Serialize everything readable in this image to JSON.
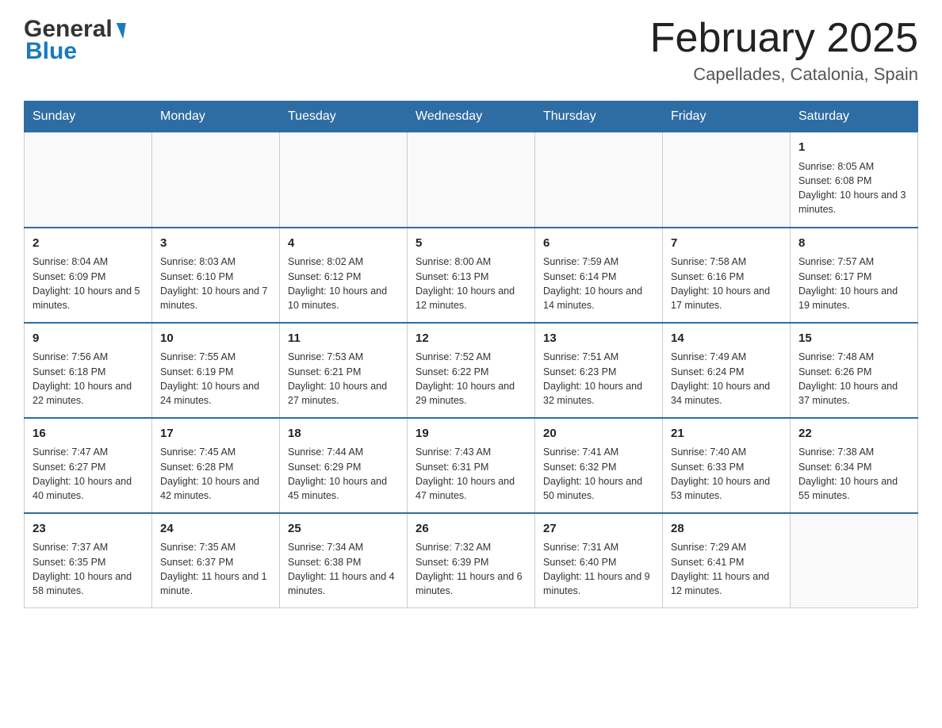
{
  "header": {
    "logo_general": "General",
    "logo_blue": "Blue",
    "title": "February 2025",
    "subtitle": "Capellades, Catalonia, Spain"
  },
  "days_of_week": [
    "Sunday",
    "Monday",
    "Tuesday",
    "Wednesday",
    "Thursday",
    "Friday",
    "Saturday"
  ],
  "weeks": [
    [
      {
        "day": "",
        "info": ""
      },
      {
        "day": "",
        "info": ""
      },
      {
        "day": "",
        "info": ""
      },
      {
        "day": "",
        "info": ""
      },
      {
        "day": "",
        "info": ""
      },
      {
        "day": "",
        "info": ""
      },
      {
        "day": "1",
        "info": "Sunrise: 8:05 AM\nSunset: 6:08 PM\nDaylight: 10 hours and 3 minutes."
      }
    ],
    [
      {
        "day": "2",
        "info": "Sunrise: 8:04 AM\nSunset: 6:09 PM\nDaylight: 10 hours and 5 minutes."
      },
      {
        "day": "3",
        "info": "Sunrise: 8:03 AM\nSunset: 6:10 PM\nDaylight: 10 hours and 7 minutes."
      },
      {
        "day": "4",
        "info": "Sunrise: 8:02 AM\nSunset: 6:12 PM\nDaylight: 10 hours and 10 minutes."
      },
      {
        "day": "5",
        "info": "Sunrise: 8:00 AM\nSunset: 6:13 PM\nDaylight: 10 hours and 12 minutes."
      },
      {
        "day": "6",
        "info": "Sunrise: 7:59 AM\nSunset: 6:14 PM\nDaylight: 10 hours and 14 minutes."
      },
      {
        "day": "7",
        "info": "Sunrise: 7:58 AM\nSunset: 6:16 PM\nDaylight: 10 hours and 17 minutes."
      },
      {
        "day": "8",
        "info": "Sunrise: 7:57 AM\nSunset: 6:17 PM\nDaylight: 10 hours and 19 minutes."
      }
    ],
    [
      {
        "day": "9",
        "info": "Sunrise: 7:56 AM\nSunset: 6:18 PM\nDaylight: 10 hours and 22 minutes."
      },
      {
        "day": "10",
        "info": "Sunrise: 7:55 AM\nSunset: 6:19 PM\nDaylight: 10 hours and 24 minutes."
      },
      {
        "day": "11",
        "info": "Sunrise: 7:53 AM\nSunset: 6:21 PM\nDaylight: 10 hours and 27 minutes."
      },
      {
        "day": "12",
        "info": "Sunrise: 7:52 AM\nSunset: 6:22 PM\nDaylight: 10 hours and 29 minutes."
      },
      {
        "day": "13",
        "info": "Sunrise: 7:51 AM\nSunset: 6:23 PM\nDaylight: 10 hours and 32 minutes."
      },
      {
        "day": "14",
        "info": "Sunrise: 7:49 AM\nSunset: 6:24 PM\nDaylight: 10 hours and 34 minutes."
      },
      {
        "day": "15",
        "info": "Sunrise: 7:48 AM\nSunset: 6:26 PM\nDaylight: 10 hours and 37 minutes."
      }
    ],
    [
      {
        "day": "16",
        "info": "Sunrise: 7:47 AM\nSunset: 6:27 PM\nDaylight: 10 hours and 40 minutes."
      },
      {
        "day": "17",
        "info": "Sunrise: 7:45 AM\nSunset: 6:28 PM\nDaylight: 10 hours and 42 minutes."
      },
      {
        "day": "18",
        "info": "Sunrise: 7:44 AM\nSunset: 6:29 PM\nDaylight: 10 hours and 45 minutes."
      },
      {
        "day": "19",
        "info": "Sunrise: 7:43 AM\nSunset: 6:31 PM\nDaylight: 10 hours and 47 minutes."
      },
      {
        "day": "20",
        "info": "Sunrise: 7:41 AM\nSunset: 6:32 PM\nDaylight: 10 hours and 50 minutes."
      },
      {
        "day": "21",
        "info": "Sunrise: 7:40 AM\nSunset: 6:33 PM\nDaylight: 10 hours and 53 minutes."
      },
      {
        "day": "22",
        "info": "Sunrise: 7:38 AM\nSunset: 6:34 PM\nDaylight: 10 hours and 55 minutes."
      }
    ],
    [
      {
        "day": "23",
        "info": "Sunrise: 7:37 AM\nSunset: 6:35 PM\nDaylight: 10 hours and 58 minutes."
      },
      {
        "day": "24",
        "info": "Sunrise: 7:35 AM\nSunset: 6:37 PM\nDaylight: 11 hours and 1 minute."
      },
      {
        "day": "25",
        "info": "Sunrise: 7:34 AM\nSunset: 6:38 PM\nDaylight: 11 hours and 4 minutes."
      },
      {
        "day": "26",
        "info": "Sunrise: 7:32 AM\nSunset: 6:39 PM\nDaylight: 11 hours and 6 minutes."
      },
      {
        "day": "27",
        "info": "Sunrise: 7:31 AM\nSunset: 6:40 PM\nDaylight: 11 hours and 9 minutes."
      },
      {
        "day": "28",
        "info": "Sunrise: 7:29 AM\nSunset: 6:41 PM\nDaylight: 11 hours and 12 minutes."
      },
      {
        "day": "",
        "info": ""
      }
    ]
  ]
}
